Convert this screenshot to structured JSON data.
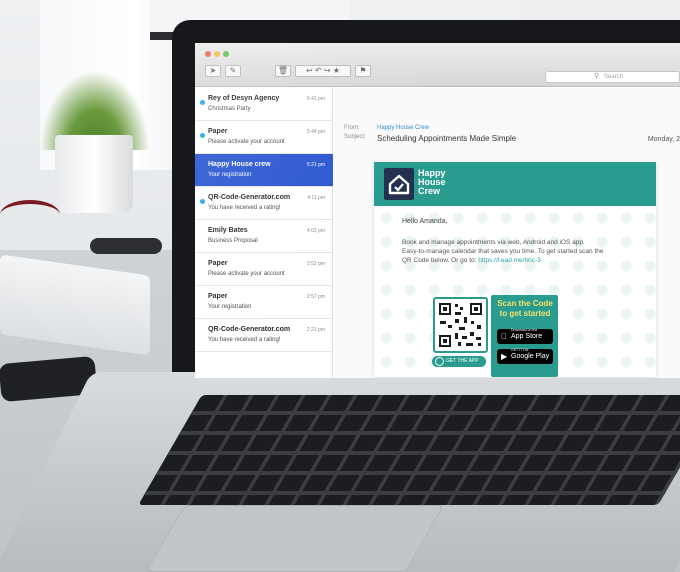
{
  "toolbar": {
    "search_placeholder": "Search"
  },
  "messages": [
    {
      "from": "Rey of Desyn Agency",
      "subject": "Christmas Party",
      "time": "6:41 pm",
      "unread": true,
      "selected": false
    },
    {
      "from": "Paper",
      "subject": "Please activate your account",
      "time": "5:44 pm",
      "unread": true,
      "selected": false
    },
    {
      "from": "Happy House crew",
      "subject": "Your registration",
      "time": "5:21 pm",
      "unread": false,
      "selected": true
    },
    {
      "from": "QR-Code-Generator.com",
      "subject": "You have received a rating!",
      "time": "4:11 pm",
      "unread": true,
      "selected": false
    },
    {
      "from": "Emily Bates",
      "subject": "Business Proposal",
      "time": "4:02 pm",
      "unread": false,
      "selected": false
    },
    {
      "from": "Paper",
      "subject": "Please activate your account",
      "time": "3:52 pm",
      "unread": false,
      "selected": false
    },
    {
      "from": "Paper",
      "subject": "Your registration",
      "time": "2:57 pm",
      "unread": false,
      "selected": false
    },
    {
      "from": "QR-Code-Generator.com",
      "subject": "You have received a rating!",
      "time": "2:21 pm",
      "unread": false,
      "selected": false
    }
  ],
  "reading": {
    "from_label": "From:",
    "from_value": "Happy House Crew",
    "subject_label": "Subject:",
    "subject_value": "Scheduling Appointments Made Simple",
    "date": "Monday, 2"
  },
  "email": {
    "brand_name_line1": "Happy",
    "brand_name_line2": "House",
    "brand_name_line3": "Crew",
    "greeting": "Hello Amanda,",
    "body_line1": "Book and manage appointments via web, Android and iOS app.",
    "body_line2": "Easy-to-manage calendar that saves you time. To get started scan the",
    "body_line3_pre": "QR Code below. Or go to: ",
    "body_link": "https://l.ead.me/hhc-3",
    "get_app": "GET THE APP",
    "scan_line1": "Scan the Code",
    "scan_line2": "to get started",
    "appstore_small": "Download on the",
    "appstore_label": "App Store",
    "googleplay_small": "GET IT ON",
    "googleplay_label": "Google Play"
  },
  "colors": {
    "selected_row": "#2c58d1",
    "unread_dot": "#29a8df",
    "brand_teal": "#2a9c8f",
    "brand_navy": "#24304f",
    "scan_yellow": "#f5e06a"
  }
}
